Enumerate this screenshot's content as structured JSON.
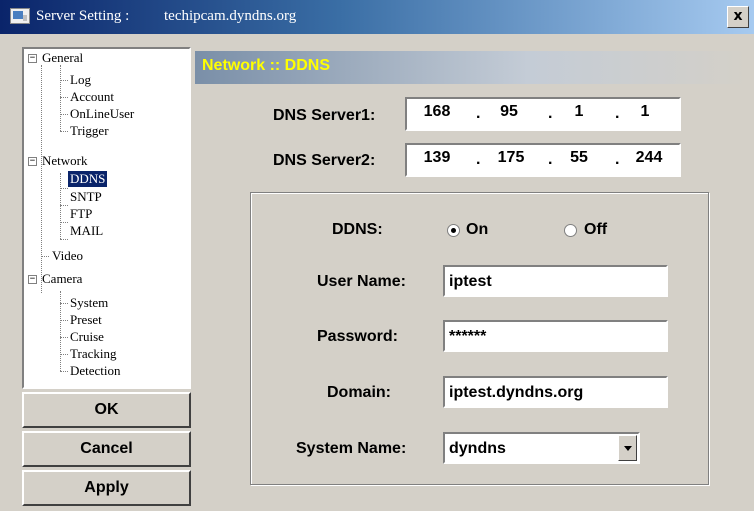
{
  "window": {
    "title": "Server Setting :",
    "host": "techipcam.dyndns.org",
    "close_label": "x"
  },
  "tree": {
    "expand_minus": "−",
    "items": [
      {
        "label": "General",
        "level": 0,
        "expanded": true
      },
      {
        "label": "Log",
        "level": 1
      },
      {
        "label": "Account",
        "level": 1
      },
      {
        "label": "OnLineUser",
        "level": 1
      },
      {
        "label": "Trigger",
        "level": 1
      },
      {
        "label": "Network",
        "level": 0,
        "expanded": true
      },
      {
        "label": "DDNS",
        "level": 1,
        "selected": true
      },
      {
        "label": "SNTP",
        "level": 1
      },
      {
        "label": "FTP",
        "level": 1
      },
      {
        "label": "MAIL",
        "level": 1
      },
      {
        "label": "Video",
        "level": 0
      },
      {
        "label": "Camera",
        "level": 0,
        "expanded": true
      },
      {
        "label": "System",
        "level": 1
      },
      {
        "label": "Preset",
        "level": 1
      },
      {
        "label": "Cruise",
        "level": 1
      },
      {
        "label": "Tracking",
        "level": 1
      },
      {
        "label": "Detection",
        "level": 1
      }
    ]
  },
  "buttons": {
    "ok": "OK",
    "cancel": "Cancel",
    "apply": "Apply"
  },
  "panel": {
    "header": "Network :: DDNS"
  },
  "dns": {
    "server1_label": "DNS Server1:",
    "server1": [
      "168",
      "95",
      "1",
      "1"
    ],
    "server2_label": "DNS Server2:",
    "server2": [
      "139",
      "175",
      "55",
      "244"
    ],
    "separator": "."
  },
  "ddns": {
    "label": "DDNS:",
    "on_label": "On",
    "off_label": "Off",
    "selected": "On",
    "username_label": "User Name:",
    "username": "iptest",
    "password_label": "Password:",
    "password": "******",
    "domain_label": "Domain:",
    "domain": "iptest.dyndns.org",
    "system_name_label": "System Name:",
    "system_name": "dyndns"
  },
  "colors": {
    "titlebar": "#0a246a",
    "panel_header_text": "#ffff00",
    "selection": "#0a246a",
    "face": "#d4d0c8"
  }
}
